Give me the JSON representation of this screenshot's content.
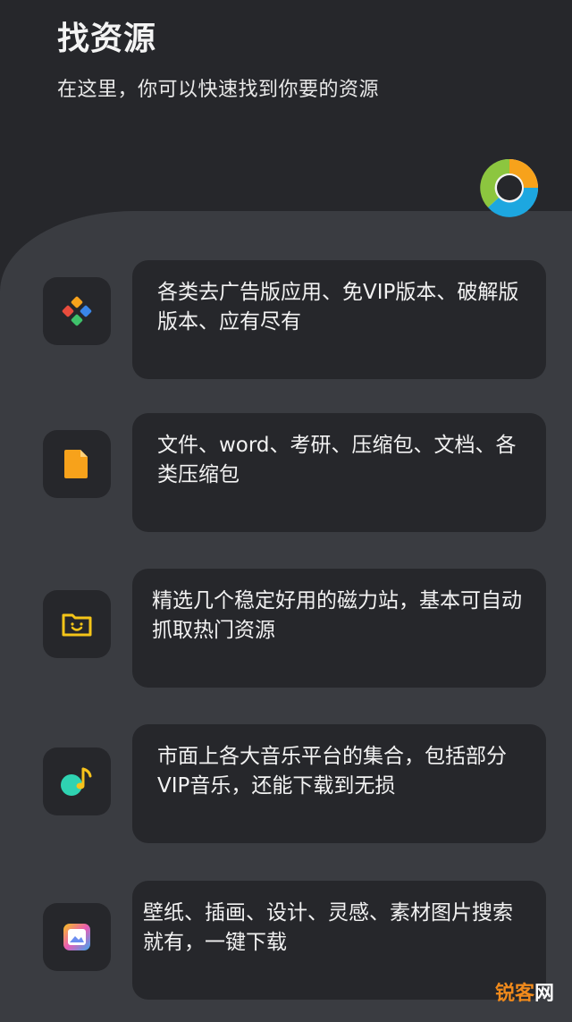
{
  "header": {
    "title": "找资源",
    "subtitle": "在这里，你可以快速找到你要的资源"
  },
  "categories": [
    {
      "icon": "app-store-icon",
      "description": "各类去广告版应用、免VIP版本、破解版版本、应有尽有"
    },
    {
      "icon": "document-icon",
      "description": "文件、word、考研、压缩包、文档、各类压缩包"
    },
    {
      "icon": "magnet-folder-icon",
      "description": "精选几个稳定好用的磁力站，基本可自动抓取热门资源"
    },
    {
      "icon": "music-note-icon",
      "description": "市面上各大音乐平台的集合，包括部分VIP音乐，还能下载到无损"
    },
    {
      "icon": "gallery-image-icon",
      "description": "壁纸、插画、设计、灵感、素材图片搜索就有，一键下载"
    }
  ],
  "watermark": {
    "part1": "锐客",
    "part2": "网"
  },
  "colors": {
    "background": "#26272b",
    "panel": "#3a3c41",
    "card": "#26272b",
    "accent_orange": "#f7a21b",
    "accent_blue": "#1da7e0",
    "accent_green": "#8cc63f"
  }
}
